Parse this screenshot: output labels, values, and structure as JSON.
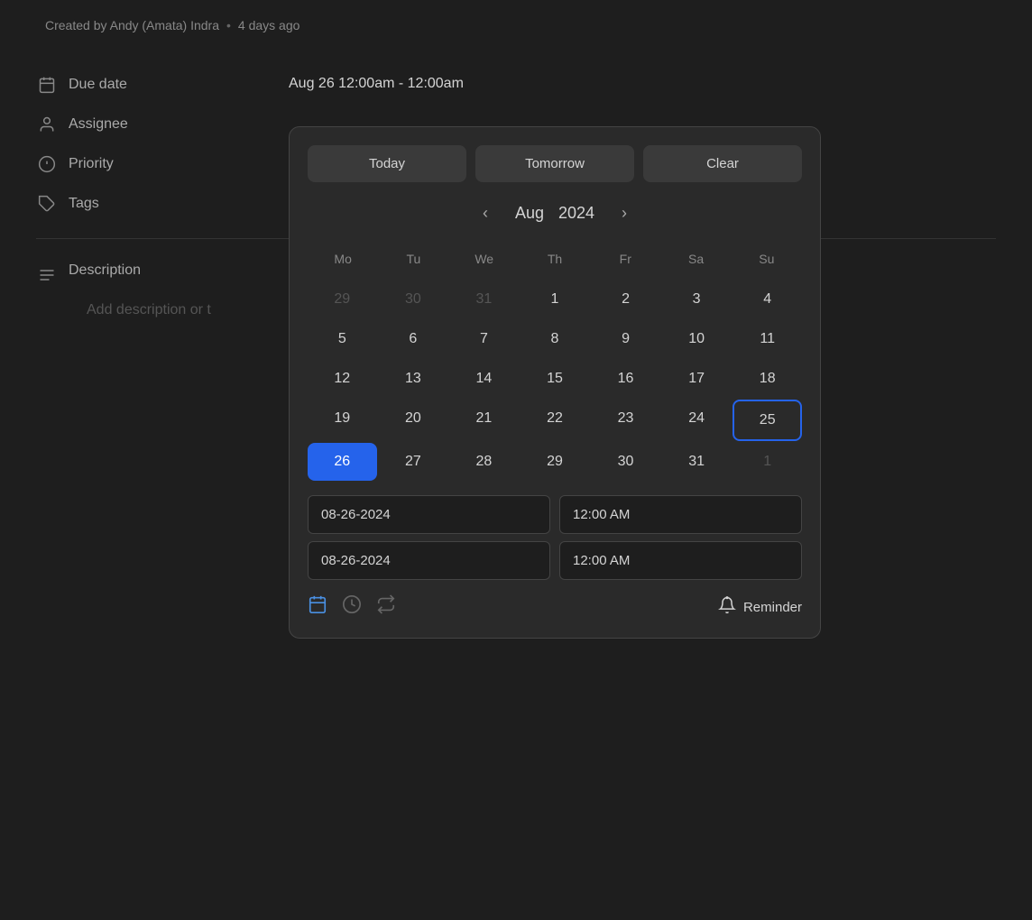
{
  "meta": {
    "created_by": "Created by Andy (Amata) Indra",
    "dot": "•",
    "time_ago": "4 days ago"
  },
  "properties": {
    "due_date": {
      "label": "Due date",
      "value": "Aug 26 12:00am - 12:00am"
    },
    "assignee": {
      "label": "Assignee"
    },
    "priority": {
      "label": "Priority"
    },
    "tags": {
      "label": "Tags"
    }
  },
  "description": {
    "label": "Description",
    "placeholder": "Add description or t"
  },
  "calendar": {
    "today_btn": "Today",
    "tomorrow_btn": "Tomorrow",
    "clear_btn": "Clear",
    "month": "Aug",
    "year": "2024",
    "day_headers": [
      "Mo",
      "Tu",
      "We",
      "Th",
      "Fr",
      "Sa",
      "Su"
    ],
    "weeks": [
      [
        {
          "day": "29",
          "type": "other-month"
        },
        {
          "day": "30",
          "type": "other-month"
        },
        {
          "day": "31",
          "type": "other-month"
        },
        {
          "day": "1",
          "type": "normal"
        },
        {
          "day": "2",
          "type": "normal"
        },
        {
          "day": "3",
          "type": "normal"
        },
        {
          "day": "4",
          "type": "normal"
        }
      ],
      [
        {
          "day": "5",
          "type": "normal"
        },
        {
          "day": "6",
          "type": "normal"
        },
        {
          "day": "7",
          "type": "normal"
        },
        {
          "day": "8",
          "type": "normal"
        },
        {
          "day": "9",
          "type": "normal"
        },
        {
          "day": "10",
          "type": "normal"
        },
        {
          "day": "11",
          "type": "normal"
        }
      ],
      [
        {
          "day": "12",
          "type": "normal"
        },
        {
          "day": "13",
          "type": "normal"
        },
        {
          "day": "14",
          "type": "normal"
        },
        {
          "day": "15",
          "type": "normal"
        },
        {
          "day": "16",
          "type": "normal"
        },
        {
          "day": "17",
          "type": "normal"
        },
        {
          "day": "18",
          "type": "normal"
        }
      ],
      [
        {
          "day": "19",
          "type": "normal"
        },
        {
          "day": "20",
          "type": "normal"
        },
        {
          "day": "21",
          "type": "normal"
        },
        {
          "day": "22",
          "type": "normal"
        },
        {
          "day": "23",
          "type": "normal"
        },
        {
          "day": "24",
          "type": "normal"
        },
        {
          "day": "25",
          "type": "highlighted"
        }
      ],
      [
        {
          "day": "26",
          "type": "selected-today"
        },
        {
          "day": "27",
          "type": "normal"
        },
        {
          "day": "28",
          "type": "normal"
        },
        {
          "day": "29",
          "type": "normal"
        },
        {
          "day": "30",
          "type": "normal"
        },
        {
          "day": "31",
          "type": "normal"
        },
        {
          "day": "1",
          "type": "other-month"
        }
      ]
    ],
    "start_date": "08-26-2024",
    "start_time": "12:00 AM",
    "end_date": "08-26-2024",
    "end_time": "12:00 AM",
    "reminder_label": "Reminder"
  }
}
